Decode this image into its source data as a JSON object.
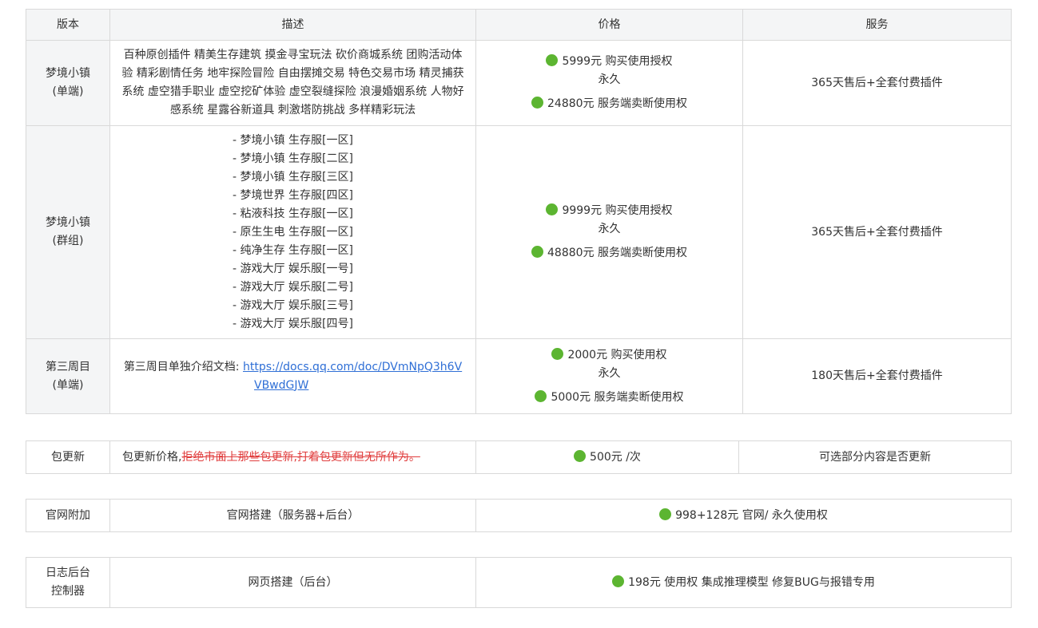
{
  "header": {
    "version": "版本",
    "description": "描述",
    "price": "价格",
    "service": "服务"
  },
  "rows": {
    "r1": {
      "version_line1": "梦境小镇",
      "version_line2": "(单端)",
      "description": "百种原创插件 精美生存建筑 摸金寻宝玩法 砍价商城系统 团购活动体验 精彩剧情任务 地牢探险冒险 自由摆摊交易 特色交易市场 精灵捕获系统 虚空猎手职业 虚空挖矿体验 虚空裂缝探险 浪漫婚姻系统 人物好感系统 星露谷新道具 刺激塔防挑战 多样精彩玩法",
      "price1": "5999元 购买使用授权",
      "price1_sub": "永久",
      "price2": "24880元 服务端卖断使用权",
      "service": "365天售后+全套付费插件"
    },
    "r2": {
      "version_line1": "梦境小镇",
      "version_line2": "(群组)",
      "servers": [
        "- 梦境小镇 生存服[一区]",
        "- 梦境小镇 生存服[二区]",
        "- 梦境小镇 生存服[三区]",
        "- 梦境世界 生存服[四区]",
        "- 粘液科技 生存服[一区]",
        "- 原生生电 生存服[一区]",
        "- 纯净生存 生存服[一区]",
        "- 游戏大厅 娱乐服[一号]",
        "- 游戏大厅 娱乐服[二号]",
        "- 游戏大厅 娱乐服[三号]",
        "- 游戏大厅 娱乐服[四号]"
      ],
      "price1": "9999元 购买使用授权",
      "price1_sub": "永久",
      "price2": "48880元 服务端卖断使用权",
      "service": "365天售后+全套付费插件"
    },
    "r3": {
      "version_line1": "第三周目",
      "version_line2": "(单端)",
      "desc_prefix": "第三周目单独介绍文档:",
      "link_line1": "https://docs.qq.com/doc/DVmNpQ3h6V",
      "link_line2": "VBwdGJW",
      "price1": "2000元 购买使用权",
      "price1_sub": "永久",
      "price2": "5000元 服务端卖断使用权",
      "service": "180天售后+全套付费插件"
    }
  },
  "update": {
    "version": "包更新",
    "desc_prefix": "包更新价格,",
    "desc_strike": "拒绝市面上那些包更新,打着包更新但无所作为。",
    "price": "500元 /次",
    "service": "可选部分内容是否更新"
  },
  "website": {
    "version": "官网附加",
    "description": "官网搭建（服务器+后台）",
    "price": "998+128元 官网/ 永久使用权"
  },
  "logs": {
    "version_line1": "日志后台",
    "version_line2": "控制器",
    "description": "网页搭建（后台）",
    "price": "198元 使用权 集成推理模型 修复BUG与报错专用"
  },
  "colors": {
    "dot": "#5cb531",
    "link": "#2f6fd6",
    "strike": "#e03c3c",
    "header_bg": "#f4f5f6",
    "border": "#d9d9d9"
  },
  "icons": {
    "status": "green-circle-icon"
  }
}
